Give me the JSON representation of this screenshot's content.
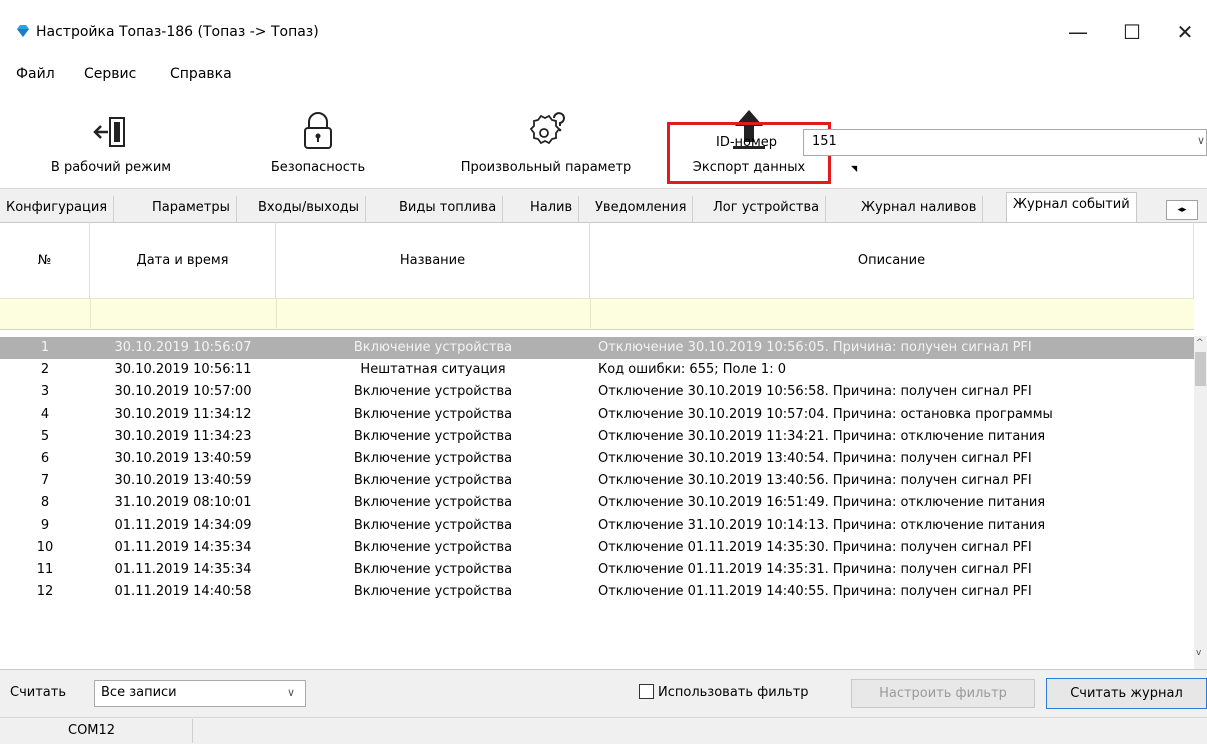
{
  "window": {
    "title": "Настройка Топаз-186 (Топаз -> Топаз)",
    "minimize": "—",
    "maximize": "☐",
    "close": "✕"
  },
  "menu": [
    "Файл",
    "Сервис",
    "Справка"
  ],
  "toolbar": {
    "work_mode": "В рабочий режим",
    "security": "Безопасность",
    "custom_param": "Произвольный параметр",
    "export": "Экспорт данных",
    "id_label": "ID-номер",
    "id_value": "151"
  },
  "tabs": [
    "Конфигурация",
    "Параметры",
    "Входы/выходы",
    "Виды топлива",
    "Налив",
    "Уведомления",
    "Лог устройства",
    "Журнал наливов",
    "Журнал событий"
  ],
  "table": {
    "headers": [
      "№",
      "Дата и время",
      "Название",
      "Описание"
    ],
    "rows": [
      [
        "1",
        "30.10.2019 10:56:07",
        "Включение устройства",
        "Отключение 30.10.2019 10:56:05. Причина: получен сигнал PFI"
      ],
      [
        "2",
        "30.10.2019 10:56:11",
        "Нештатная ситуация",
        "Код ошибки: 655; Поле 1: 0"
      ],
      [
        "3",
        "30.10.2019 10:57:00",
        "Включение устройства",
        "Отключение 30.10.2019 10:56:58. Причина: получен сигнал PFI"
      ],
      [
        "4",
        "30.10.2019 11:34:12",
        "Включение устройства",
        "Отключение 30.10.2019 10:57:04. Причина: остановка программы"
      ],
      [
        "5",
        "30.10.2019 11:34:23",
        "Включение устройства",
        "Отключение 30.10.2019 11:34:21. Причина: отключение питания"
      ],
      [
        "6",
        "30.10.2019 13:40:59",
        "Включение устройства",
        "Отключение 30.10.2019 13:40:54. Причина: получен сигнал PFI"
      ],
      [
        "7",
        "30.10.2019 13:40:59",
        "Включение устройства",
        "Отключение 30.10.2019 13:40:56. Причина: получен сигнал PFI"
      ],
      [
        "8",
        "31.10.2019 08:10:01",
        "Включение устройства",
        "Отключение 30.10.2019 16:51:49. Причина: отключение питания"
      ],
      [
        "9",
        "01.11.2019 14:34:09",
        "Включение устройства",
        "Отключение 31.10.2019 10:14:13. Причина: отключение питания"
      ],
      [
        "10",
        "01.11.2019 14:35:34",
        "Включение устройства",
        "Отключение 01.11.2019 14:35:30. Причина: получен сигнал PFI"
      ],
      [
        "11",
        "01.11.2019 14:35:34",
        "Включение устройства",
        "Отключение 01.11.2019 14:35:31. Причина: получен сигнал PFI"
      ],
      [
        "12",
        "01.11.2019 14:40:58",
        "Включение устройства",
        "Отключение 01.11.2019 14:40:55. Причина: получен сигнал PFI"
      ]
    ]
  },
  "footer": {
    "read_label": "Считать",
    "read_value": "Все записи",
    "use_filter": "Использовать фильтр",
    "setup_filter": "Настроить фильтр",
    "read_journal": "Считать журнал"
  },
  "status": {
    "port": "COM12"
  },
  "colors": {
    "highlight_border": "#e01c1c",
    "selected_row": "#b0b0b0",
    "filter_row": "#fdfde0",
    "focus_button_border": "#2d7bd6"
  }
}
